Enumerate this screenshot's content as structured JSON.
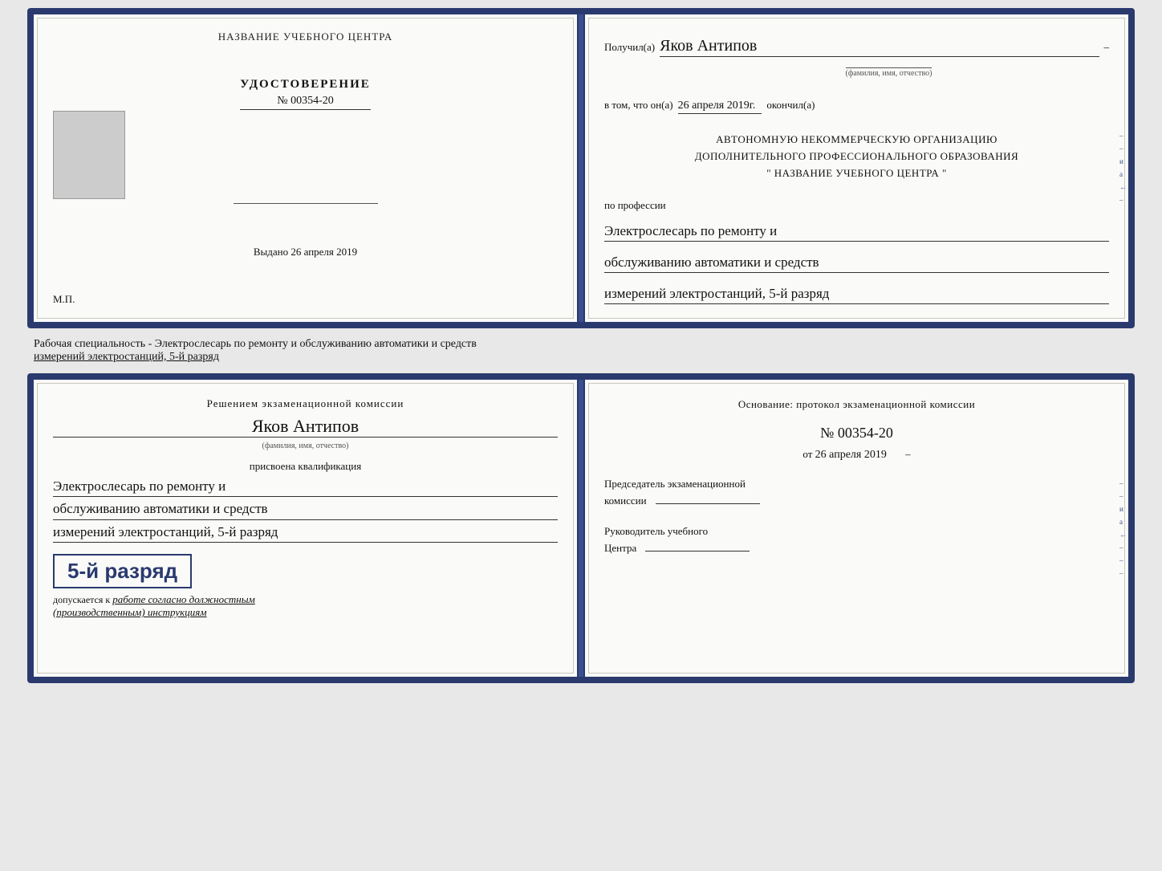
{
  "top_book": {
    "left_page": {
      "center_title": "НАЗВАНИЕ УЧЕБНОГО ЦЕНТРА",
      "udostoverenie": {
        "title": "УДОСТОВЕРЕНИЕ",
        "number": "№ 00354-20"
      },
      "vydano": "Выдано 26 апреля 2019",
      "mp": "М.П."
    },
    "right_page": {
      "received_label": "Получил(а)",
      "recipient_name": "Яков Антипов",
      "fio_label": "(фамилия, имя, отчество)",
      "vtom_label": "в том, что он(а)",
      "date": "26 апреля 2019г.",
      "okonchil": "окончил(а)",
      "org_line1": "АВТОНОМНУЮ НЕКОММЕРЧЕСКУЮ ОРГАНИЗАЦИЮ",
      "org_line2": "ДОПОЛНИТЕЛЬНОГО ПРОФЕССИОНАЛЬНОГО ОБРАЗОВАНИЯ",
      "org_quote": "\"   НАЗВАНИЕ УЧЕБНОГО ЦЕНТРА   \"",
      "po_professii": "по профессии",
      "profession_line1": "Электрослесарь по ремонту и",
      "profession_line2": "обслуживанию автоматики и средств",
      "profession_line3": "измерений электростанций, 5-й разряд"
    }
  },
  "label_between": {
    "text": "Рабочая специальность - Электрослесарь по ремонту и обслуживанию автоматики и средств",
    "text2": "измерений электростанций, 5-й разряд"
  },
  "bottom_book": {
    "left_page": {
      "resheniem": "Решением экзаменационной комиссии",
      "name": "Яков Антипов",
      "fio_label": "(фамилия, имя, отчество)",
      "prisvoena": "присвоена квалификация",
      "qualification_line1": "Электрослесарь по ремонту и",
      "qualification_line2": "обслуживанию автоматики и средств",
      "qualification_line3": "измерений электростанций, 5-й разряд",
      "razryad": "5-й разряд",
      "dopuskaetsya_label": "допускается к",
      "dopuskaetsya_text": "работе согласно должностным",
      "dopuskaetsya_text2": "(производственным) инструкциям"
    },
    "right_page": {
      "osnovanie_label": "Основание: протокол экзаменационной комиссии",
      "protocol_number": "№ 00354-20",
      "ot_label": "от",
      "ot_date": "26 апреля 2019",
      "predsedatel_label": "Председатель экзаменационной",
      "predsedatel_label2": "комиссии",
      "rukovoditel_label": "Руководитель учебного",
      "rukovoditel_label2": "Центра"
    }
  },
  "side_markers": {
    "items": [
      "и",
      "а",
      "←",
      "–",
      "–",
      "–"
    ]
  }
}
